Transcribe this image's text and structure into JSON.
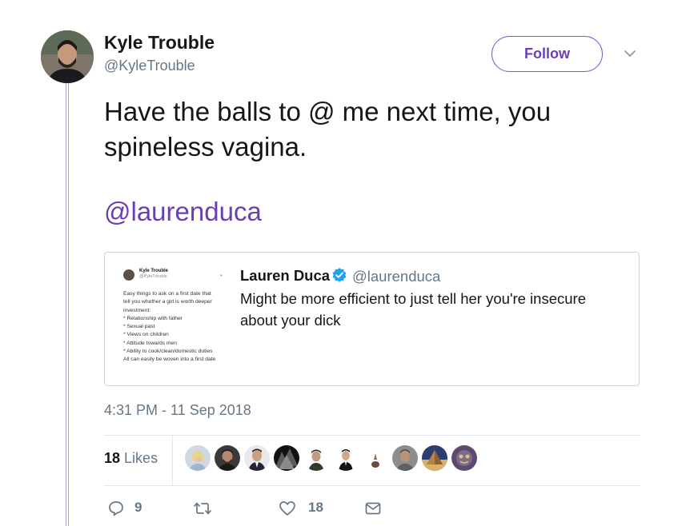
{
  "author": {
    "name": "Kyle Trouble",
    "handle": "@KyleTrouble"
  },
  "follow_label": "Follow",
  "tweet": {
    "text": "Have the balls to @ me next time, you spineless vagina.",
    "mention": "@laurenduca"
  },
  "quoted": {
    "name": "Lauren Duca",
    "handle": "@laurenduca",
    "text": "Might be more efficient to just tell her you're insecure about your dick",
    "image": {
      "name": "Kyle Trouble",
      "handle": "@KyleTrouble",
      "lines": [
        "Easy things to ask on a first date that",
        "tell you whether a girl is worth deeper",
        "investment:",
        "* Relationship with father",
        "* Sexual past",
        "* Views on children",
        "* Attitude towards men",
        "* Ability to cook/clean/domestic duties",
        "All can easily be woven into a first date"
      ]
    }
  },
  "timestamp": "4:31 PM - 11 Sep 2018",
  "likes": {
    "count": "18",
    "label": "Likes"
  },
  "actions": {
    "replies": "9",
    "likes": "18"
  },
  "colors": {
    "accent": "#6a3fb3",
    "verified": "#1da1f2",
    "muted": "#657786"
  },
  "icons": [
    "chevron-down-icon",
    "verified-icon",
    "reply-icon",
    "retweet-icon",
    "heart-icon",
    "message-icon"
  ]
}
